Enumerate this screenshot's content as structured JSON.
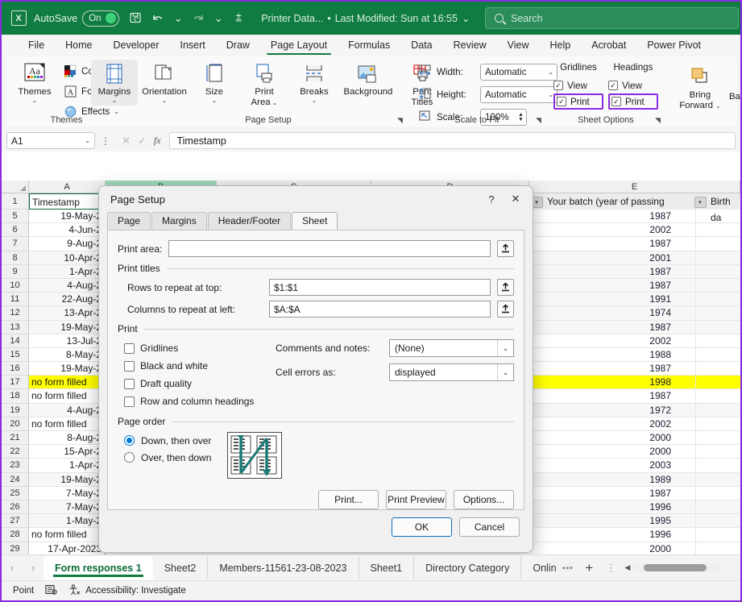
{
  "titlebar": {
    "app_icon": "excel-logo",
    "autosave_label": "AutoSave",
    "autosave_state": "On",
    "save_icon": "save-icon",
    "undo_icon": "undo-icon",
    "redo_icon": "redo-icon",
    "customize_icon": "customize-qat-icon",
    "document_name": "Printer Data...",
    "separator_dot": "•",
    "last_modified": "Last Modified: Sun at 16:55",
    "search_placeholder": "Search"
  },
  "ribbon_tabs": [
    {
      "label": "File",
      "active": false
    },
    {
      "label": "Home",
      "active": false
    },
    {
      "label": "Developer",
      "active": false
    },
    {
      "label": "Insert",
      "active": false
    },
    {
      "label": "Draw",
      "active": false
    },
    {
      "label": "Page Layout",
      "active": true
    },
    {
      "label": "Formulas",
      "active": false
    },
    {
      "label": "Data",
      "active": false
    },
    {
      "label": "Review",
      "active": false
    },
    {
      "label": "View",
      "active": false
    },
    {
      "label": "Help",
      "active": false
    },
    {
      "label": "Acrobat",
      "active": false
    },
    {
      "label": "Power Pivot",
      "active": false
    }
  ],
  "ribbon": {
    "themes_group": {
      "title": "Themes",
      "themes_button": "Themes",
      "colors": "Colors",
      "fonts": "Fonts",
      "effects": "Effects"
    },
    "page_setup_group": {
      "title": "Page Setup",
      "items": [
        {
          "label": "Margins",
          "selected": true
        },
        {
          "label": "Orientation",
          "selected": false
        },
        {
          "label": "Size",
          "selected": false
        },
        {
          "label": "Print\nArea",
          "line1": "Print",
          "line2": "Area",
          "selected": false
        },
        {
          "label": "Breaks",
          "selected": false
        },
        {
          "label": "Background",
          "selected": false
        },
        {
          "label": "Print Titles",
          "line1": "Print",
          "line2": "Titles",
          "selected": false
        }
      ]
    },
    "scale_to_fit_group": {
      "title": "Scale to Fit",
      "width_label": "Width:",
      "width_value": "Automatic",
      "height_label": "Height:",
      "height_value": "Automatic",
      "scale_label": "Scale:",
      "scale_value": "100%"
    },
    "sheet_options_group": {
      "title": "Sheet Options",
      "gridlines_label": "Gridlines",
      "headings_label": "Headings",
      "gridlines_view": "View",
      "gridlines_print": "Print",
      "headings_view": "View",
      "headings_print": "Print",
      "highlight_color": "#8a2be2"
    },
    "arrange_group": {
      "bring_forward_line1": "Bring",
      "bring_forward_line2": "Forward",
      "send_backward_partial": "Ba"
    }
  },
  "formula_bar": {
    "name_box": "A1",
    "cancel_icon": "cancel-icon",
    "enter_icon": "enter-icon",
    "fx_icon": "fx-icon",
    "formula_value": "Timestamp"
  },
  "grid": {
    "column_headers": [
      "A",
      "B",
      "C",
      "D",
      "E"
    ],
    "selected_column": "B",
    "table_header_e": "Your batch (year of passing",
    "table_header_f": "Birth da",
    "header_row": {
      "num": "1",
      "a": "Timestamp"
    },
    "rows": [
      {
        "num": "5",
        "a": "19-May-2",
        "e": "1987",
        "band": false
      },
      {
        "num": "6",
        "a": "4-Jun-2",
        "e": "2002",
        "band": false
      },
      {
        "num": "7",
        "a": "9-Aug-2",
        "e": "1987",
        "band": false
      },
      {
        "num": "8",
        "a": "10-Apr-2",
        "e": "2001",
        "band": true
      },
      {
        "num": "9",
        "a": "1-Apr-2",
        "e": "1987",
        "band": true
      },
      {
        "num": "10",
        "a": "4-Aug-2",
        "e": "1987",
        "band": true
      },
      {
        "num": "11",
        "a": "22-Aug-2",
        "e": "1991",
        "band": true
      },
      {
        "num": "12",
        "a": "13-Apr-2",
        "e": "1974",
        "band": true
      },
      {
        "num": "13",
        "a": "19-May-2",
        "e": "1987",
        "band": true
      },
      {
        "num": "14",
        "a": "13-Jul-2",
        "e": "2002",
        "band": false
      },
      {
        "num": "15",
        "a": "8-May-2",
        "e": "1988",
        "band": false
      },
      {
        "num": "16",
        "a": "19-May-2",
        "e": "1987",
        "band": false
      },
      {
        "num": "17",
        "a": "no form filled",
        "e": "1998",
        "band": false,
        "highlight": true,
        "left": true
      },
      {
        "num": "18",
        "a": "no form filled",
        "e": "1987",
        "band": false,
        "left": true
      },
      {
        "num": "19",
        "a": "4-Aug-2",
        "e": "1972",
        "band": true
      },
      {
        "num": "20",
        "a": "no form filled",
        "e": "2002",
        "band": false,
        "left": true
      },
      {
        "num": "21",
        "a": "8-Aug-2",
        "e": "2000",
        "band": false
      },
      {
        "num": "22",
        "a": "15-Apr-2",
        "e": "2000",
        "band": false
      },
      {
        "num": "23",
        "a": "1-Apr-2",
        "e": "2003",
        "band": false
      },
      {
        "num": "24",
        "a": "19-May-2",
        "e": "1989",
        "band": true
      },
      {
        "num": "25",
        "a": "7-May-2",
        "e": "1987",
        "band": false
      },
      {
        "num": "26",
        "a": "7-May-2",
        "e": "1996",
        "band": true
      },
      {
        "num": "27",
        "a": "1-May-2",
        "e": "1995",
        "band": true
      },
      {
        "num": "28",
        "a": "no form filled",
        "e": "1996",
        "band": false,
        "left": true
      },
      {
        "num": "29",
        "a": "17-Apr-2023",
        "e": "2000",
        "band": false
      }
    ]
  },
  "dialog": {
    "title": "Page Setup",
    "help_icon": "help-icon",
    "close_icon": "close-icon",
    "tabs": [
      {
        "label": "Page",
        "active": false
      },
      {
        "label": "Margins",
        "active": false
      },
      {
        "label": "Header/Footer",
        "active": false
      },
      {
        "label": "Sheet",
        "active": true
      }
    ],
    "print_area_label": "Print area:",
    "print_area_value": "",
    "print_titles_legend": "Print titles",
    "rows_repeat_label": "Rows to repeat at top:",
    "rows_repeat_value": "$1:$1",
    "cols_repeat_label": "Columns to repeat at left:",
    "cols_repeat_value": "$A:$A",
    "collapse_icon": "collapse-dialog-icon",
    "print_legend": "Print",
    "checkboxes": [
      {
        "label": "Gridlines",
        "checked": false
      },
      {
        "label": "Black and white",
        "checked": false
      },
      {
        "label": "Draft quality",
        "checked": false
      },
      {
        "label": "Row and column headings",
        "checked": false
      }
    ],
    "comments_label": "Comments and notes:",
    "comments_value": "(None)",
    "cellerrors_label": "Cell errors as:",
    "cellerrors_value": "displayed",
    "page_order_legend": "Page order",
    "page_order_options": [
      {
        "label": "Down, then over",
        "selected": true
      },
      {
        "label": "Over, then down",
        "selected": false
      }
    ],
    "page_order_preview_icon": "page-order-preview",
    "buttons_mid": [
      "Print...",
      "Print Preview",
      "Options..."
    ],
    "ok_label": "OK",
    "cancel_label": "Cancel"
  },
  "sheet_tabs": {
    "prev_icon": "prev-sheet-icon",
    "next_icon": "next-sheet-icon",
    "tabs": [
      {
        "label": "Form responses 1",
        "active": true
      },
      {
        "label": "Sheet2",
        "active": false
      },
      {
        "label": "Members-11561-23-08-2023",
        "active": false
      },
      {
        "label": "Sheet1",
        "active": false
      },
      {
        "label": "Directory Category",
        "active": false
      },
      {
        "label": "Online",
        "active": false
      }
    ],
    "overflow_icon": "more-sheets-icon",
    "add_icon": "add-sheet-icon",
    "menu_icon": "sheet-menu-icon"
  },
  "statusbar": {
    "mode": "Point",
    "recording_icon": "macro-record-icon",
    "accessibility_icon": "accessibility-icon",
    "accessibility_text": "Accessibility: Investigate"
  }
}
